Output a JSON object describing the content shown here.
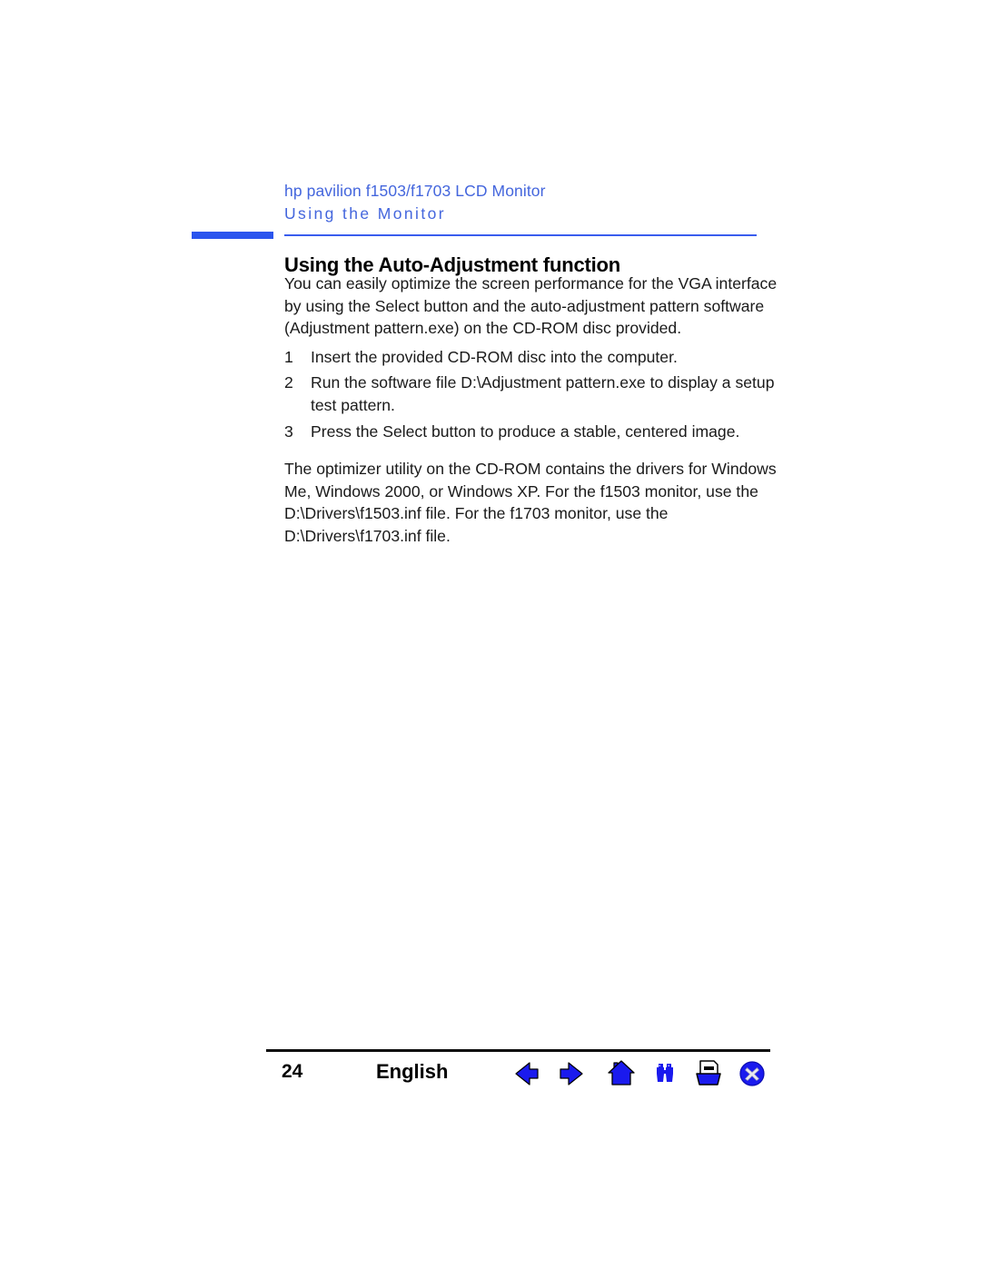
{
  "document": {
    "product_title": "hp pavilion f1503/f1703 LCD Monitor",
    "chapter_title": "Using the Monitor",
    "section_heading": "Using the Auto-Adjustment function"
  },
  "body": {
    "intro_paragraph": "You can easily optimize the screen performance for the VGA interface by using the Select button and the auto-adjustment pattern software (Adjustment pattern.exe) on the CD-ROM disc provided.",
    "steps": [
      {
        "number": "1",
        "text": "Insert the provided CD-ROM disc into the computer."
      },
      {
        "number": "2",
        "text": "Run the software file D:\\Adjustment pattern.exe to display a setup test pattern."
      },
      {
        "number": "3",
        "text": "Press the Select button to produce a stable, centered image."
      }
    ],
    "closing_paragraph": "The optimizer utility on the CD-ROM contains the drivers for Windows Me, Windows 2000, or Windows XP. For the f1503 monitor, use the D:\\Drivers\\f1503.inf file. For the f1703 monitor, use the D:\\Drivers\\f1703.inf file."
  },
  "footer": {
    "page_number": "24",
    "language": "English",
    "nav": [
      {
        "name": "previous-page",
        "label": "Previous page"
      },
      {
        "name": "next-page",
        "label": "Next page"
      },
      {
        "name": "home",
        "label": "Home"
      },
      {
        "name": "search",
        "label": "Search"
      },
      {
        "name": "print",
        "label": "Print"
      },
      {
        "name": "close",
        "label": "Close"
      }
    ]
  },
  "colors": {
    "header_blue": "#4466DD",
    "tab_blue": "#2B55EE",
    "rule_blue": "#3A5DEE",
    "icon_blue": "#1A1AEE",
    "footer_rule": "#0d0d0d",
    "body_text": "#1a1a1a"
  }
}
